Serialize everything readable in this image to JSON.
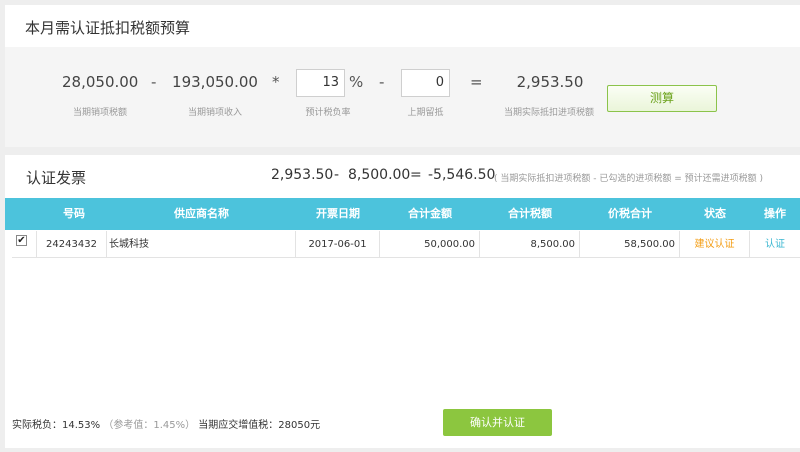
{
  "budget": {
    "title": "本月需认证抵扣税额预算",
    "sales_tax": {
      "value": "28,050.00",
      "label": "当期销项税额"
    },
    "op_minus_1": "-",
    "sales_income": {
      "value": "193,050.00",
      "label": "当期销项收入"
    },
    "op_times": "*",
    "tax_rate": {
      "value": "13",
      "unit": "%",
      "label": "预计税负率"
    },
    "op_minus_2": "-",
    "carry_over": {
      "value": "0",
      "label": "上期留抵"
    },
    "op_equals": "=",
    "result": {
      "value": "2,953.50",
      "label": "当期实际抵扣进项税额"
    },
    "calc_button": "测算"
  },
  "certify": {
    "title": "认证发票",
    "formula": {
      "a": "2,953.50",
      "op1": "-",
      "b": "8,500.00",
      "op2": "=",
      "c": "-5,546.50",
      "note": "( 当期实际抵扣进项税额 - 已勾选的进项税额 = 预计还需进项税额 )"
    },
    "columns": [
      "号码",
      "供应商名称",
      "开票日期",
      "合计金额",
      "合计税额",
      "价税合计",
      "状态",
      "操作"
    ],
    "rows": [
      {
        "checked": true,
        "number": "24243432",
        "supplier": "长城科技",
        "date": "2017-06-01",
        "amount": "50,000.00",
        "tax": "8,500.00",
        "total": "58,500.00",
        "status": "建议认证",
        "action": "认证"
      }
    ],
    "footer": {
      "actual_rate": "实际税负：14.53%",
      "reference": "（参考值：1.45%）",
      "vat_due": "当期应交增值税：28050元"
    },
    "confirm_button": "确认并认证"
  },
  "colors": {
    "table_header": "#4cc3dc",
    "accent_green": "#8cc63f",
    "status_orange": "#f39c12",
    "action_cyan": "#3bb7d1"
  }
}
